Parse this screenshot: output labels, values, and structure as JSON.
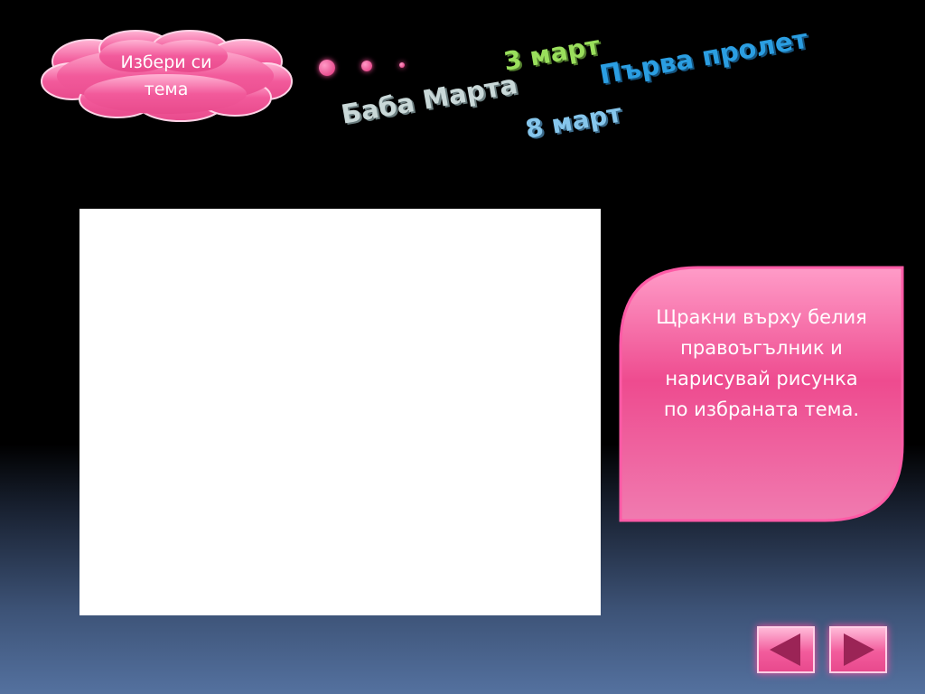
{
  "topic_menu": {
    "label": "Избери си тема"
  },
  "topics": {
    "baba_marta": "Баба Марта",
    "march_3": "3 март",
    "first_spring": "Първа пролет",
    "march_8": "8 март"
  },
  "instructions": {
    "text": "Щракни върху белия правоъгълник и нарисувай рисунка по избраната тема."
  },
  "navigation": {
    "prev_icon": "triangle-left-icon",
    "next_icon": "triangle-right-icon"
  },
  "colors": {
    "accent_pink": "#ee4b8f",
    "topic_green": "#9adf5c",
    "topic_blue": "#2b9ee2",
    "topic_lightblue": "#86c6ec",
    "topic_grey": "#c9d8d8"
  }
}
